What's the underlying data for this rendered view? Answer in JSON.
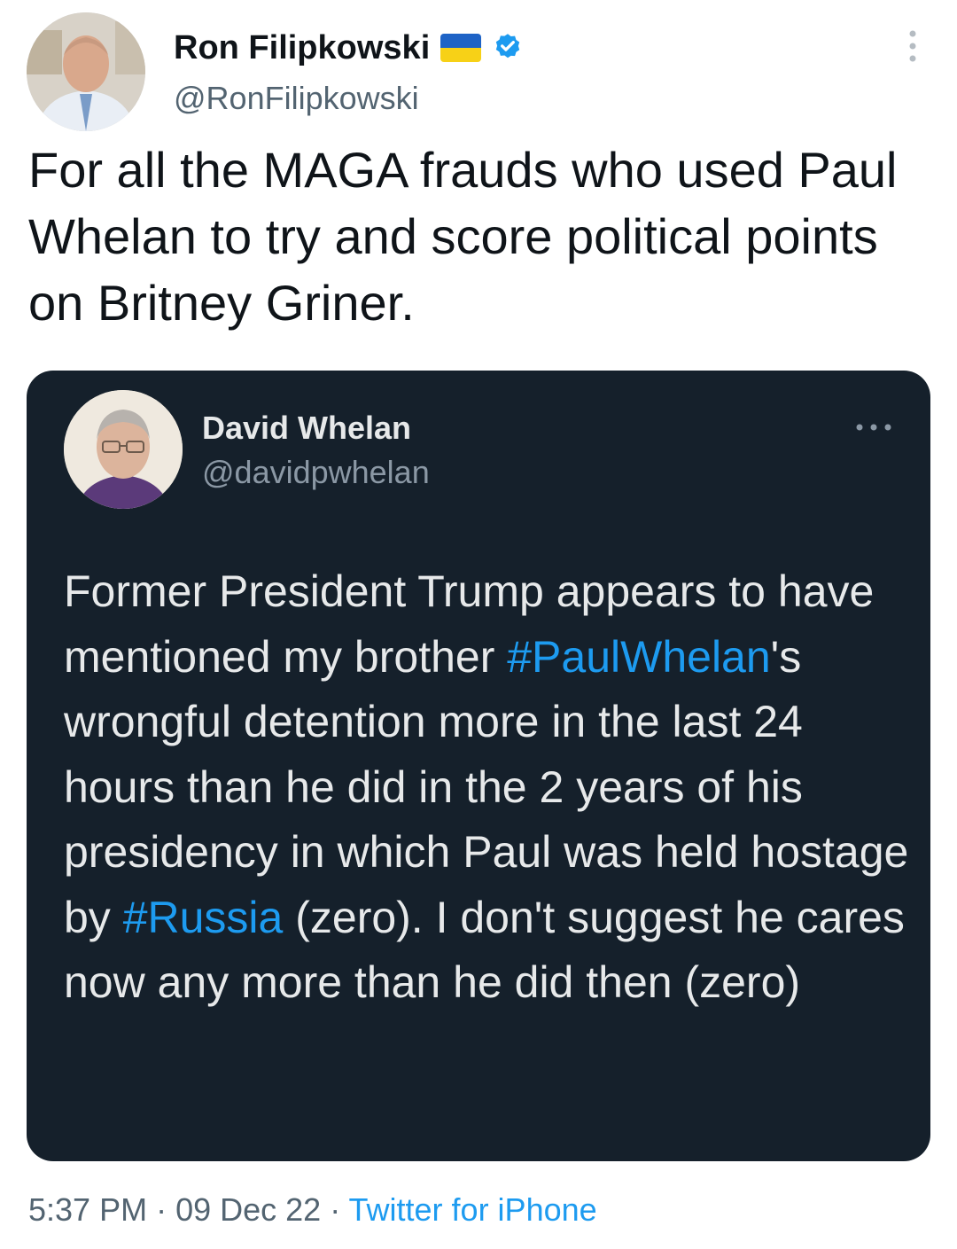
{
  "author": {
    "display_name": "Ron Filipkowski",
    "handle": "@RonFilipkowski",
    "flag_icon": "ukraine-flag-icon",
    "verified_icon": "verified-badge-icon"
  },
  "tweet": {
    "text": "For all the MAGA frauds who used Paul Whelan to try and score political points on Britney Griner."
  },
  "quote": {
    "display_name": "David Whelan",
    "handle": "@davidpwhelan",
    "text_parts": {
      "p1": "Former President Trump appears to have mentioned my brother ",
      "hashtag1": "#PaulWhelan",
      "p2": "'s wrongful detention more in the last 24 hours than he did in the 2 years of his presidency   in which Paul was held hostage by ",
      "hashtag2": "#Russia",
      "p3": " (zero).  I don't suggest he cares now any more than he did then (zero)"
    }
  },
  "meta": {
    "time": "5:37 PM",
    "date": "09 Dec 22",
    "separator": " · ",
    "source": "Twitter for iPhone"
  },
  "colors": {
    "link": "#1d9bf0",
    "secondary_text": "#536471",
    "quote_background": "#15202b"
  }
}
